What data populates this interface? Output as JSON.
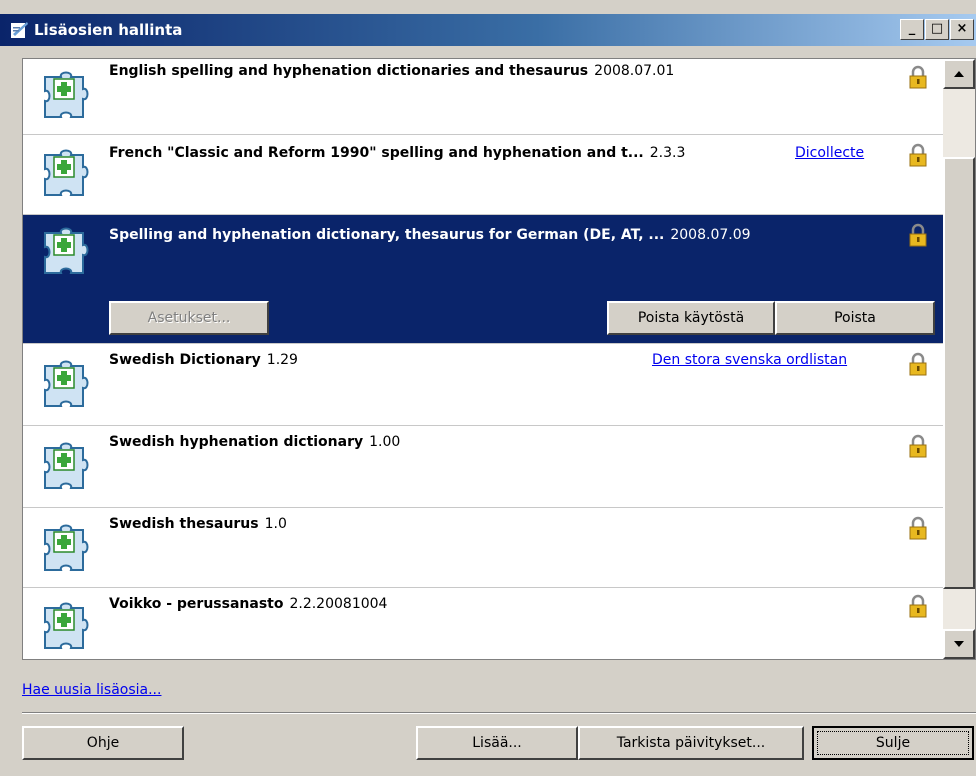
{
  "window": {
    "title": "Lisäosien hallinta",
    "minimize": "_",
    "maximize": "□",
    "close": "×"
  },
  "extensions": [
    {
      "name": "English spelling and hyphenation dictionaries and thesaurus",
      "version": "2008.07.01",
      "link": ""
    },
    {
      "name": "French \"Classic and Reform 1990\" spelling and hyphenation and t...",
      "version": "2.3.3",
      "link": "Dicollecte"
    },
    {
      "name": "Spelling and hyphenation dictionary, thesaurus for German (DE, AT, ...",
      "version": "2008.07.09",
      "link": "",
      "selected": true
    },
    {
      "name": "Swedish Dictionary",
      "version": "1.29",
      "link": "Den stora svenska ordlistan"
    },
    {
      "name": "Swedish hyphenation dictionary",
      "version": "1.00",
      "link": ""
    },
    {
      "name": "Swedish thesaurus",
      "version": "1.0",
      "link": ""
    },
    {
      "name": "Voikko - perussanasto",
      "version": "2.2.20081004",
      "link": ""
    }
  ],
  "selected_actions": {
    "options": "Asetukset...",
    "disable": "Poista käytöstä",
    "remove": "Poista"
  },
  "get_more_link": "Hae uusia lisäosia...",
  "footer": {
    "help": "Ohje",
    "add": "Lisää...",
    "check_updates": "Tarkista päivitykset...",
    "close": "Sulje"
  },
  "colors": {
    "selection": "#0a246a",
    "link": "#0000ee",
    "face": "#d4d0c8"
  }
}
